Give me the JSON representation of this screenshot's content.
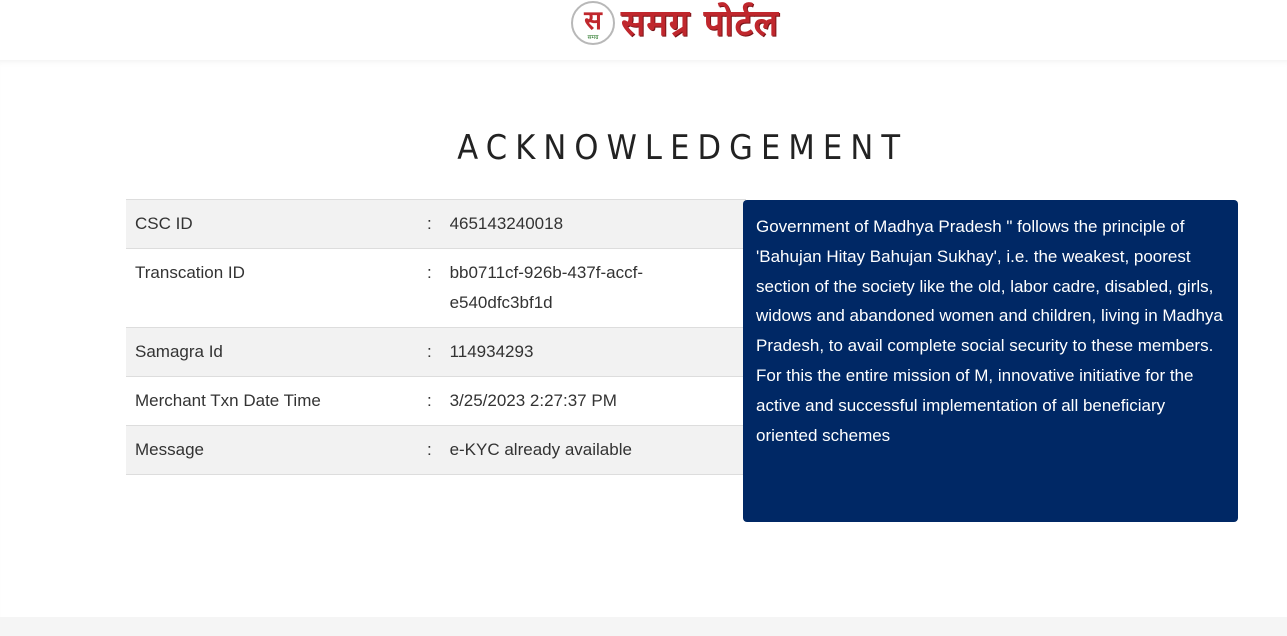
{
  "header": {
    "logo_text": "समग्र पोर्टल",
    "logo_emblem_glyph": "स",
    "logo_emblem_caption": "समग्र"
  },
  "page_title": "ACKNOWLEDGEMENT",
  "details": {
    "separator": ":",
    "rows": [
      {
        "label": "CSC ID",
        "value": "465143240018"
      },
      {
        "label": "Transcation ID",
        "value": "bb0711cf-926b-437f-accf-e540dfc3bf1d"
      },
      {
        "label": "Samagra Id",
        "value": "114934293"
      },
      {
        "label": "Merchant Txn Date Time",
        "value": "3/25/2023 2:27:37 PM"
      },
      {
        "label": "Message",
        "value": "e-KYC already available"
      }
    ]
  },
  "info_panel": {
    "text": "Government of Madhya Pradesh \" follows the principle of 'Bahujan Hitay Bahujan Sukhay', i.e. the weakest, poorest section of the society like the old, labor cadre, disabled, girls, widows and abandoned women and children, living in Madhya Pradesh, to avail complete social security to these members. For this the entire mission of M, innovative initiative for the active and successful implementation of all beneficiary oriented schemes",
    "background": "#002865"
  },
  "colors": {
    "brand_red": "#c0272d",
    "panel_blue": "#002865",
    "row_shade": "#f2f2f2"
  }
}
